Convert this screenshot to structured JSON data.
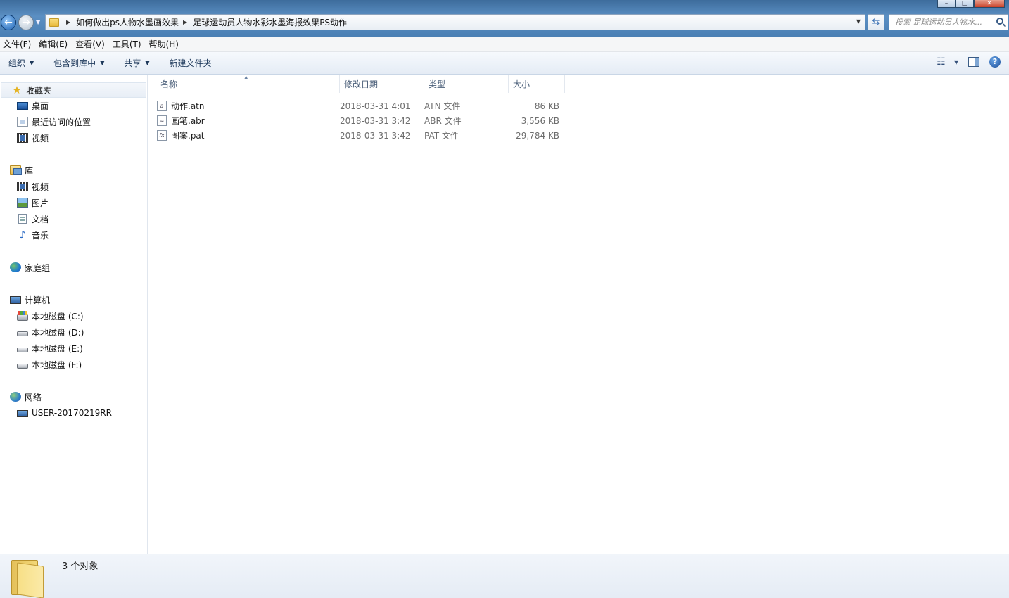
{
  "window": {
    "buttons": {
      "minimize": "–",
      "maximize": "□",
      "close": "✕"
    }
  },
  "address": {
    "breadcrumbs": [
      "如何做出ps人物水墨画效果",
      "足球运动员人物水彩水墨海报效果PS动作"
    ],
    "search_placeholder": "搜索 足球运动员人物水..."
  },
  "menubar": [
    "文件(F)",
    "编辑(E)",
    "查看(V)",
    "工具(T)",
    "帮助(H)"
  ],
  "toolbar": {
    "organize": "组织",
    "include_in_library": "包含到库中",
    "share": "共享",
    "new_folder": "新建文件夹"
  },
  "navpane": {
    "favorites": {
      "label": "收藏夹",
      "items": [
        "桌面",
        "最近访问的位置",
        "视频"
      ]
    },
    "libraries": {
      "label": "库",
      "items": [
        "视频",
        "图片",
        "文档",
        "音乐"
      ]
    },
    "homegroup": {
      "label": "家庭组"
    },
    "computer": {
      "label": "计算机",
      "items": [
        "本地磁盘 (C:)",
        "本地磁盘 (D:)",
        "本地磁盘 (E:)",
        "本地磁盘 (F:)"
      ]
    },
    "network": {
      "label": "网络",
      "items": [
        "USER-20170219RR"
      ]
    }
  },
  "filelist": {
    "columns": {
      "name": "名称",
      "date": "修改日期",
      "type": "类型",
      "size": "大小"
    },
    "files": [
      {
        "name": "动作.atn",
        "date": "2018-03-31 4:01",
        "type": "ATN 文件",
        "size": "86 KB",
        "icon": "atn-file-icon"
      },
      {
        "name": "画笔.abr",
        "date": "2018-03-31 3:42",
        "type": "ABR 文件",
        "size": "3,556 KB",
        "icon": "abr-file-icon"
      },
      {
        "name": "图案.pat",
        "date": "2018-03-31 3:42",
        "type": "PAT 文件",
        "size": "29,784 KB",
        "icon": "pat-file-icon"
      }
    ]
  },
  "status": {
    "count": "3 个对象"
  }
}
